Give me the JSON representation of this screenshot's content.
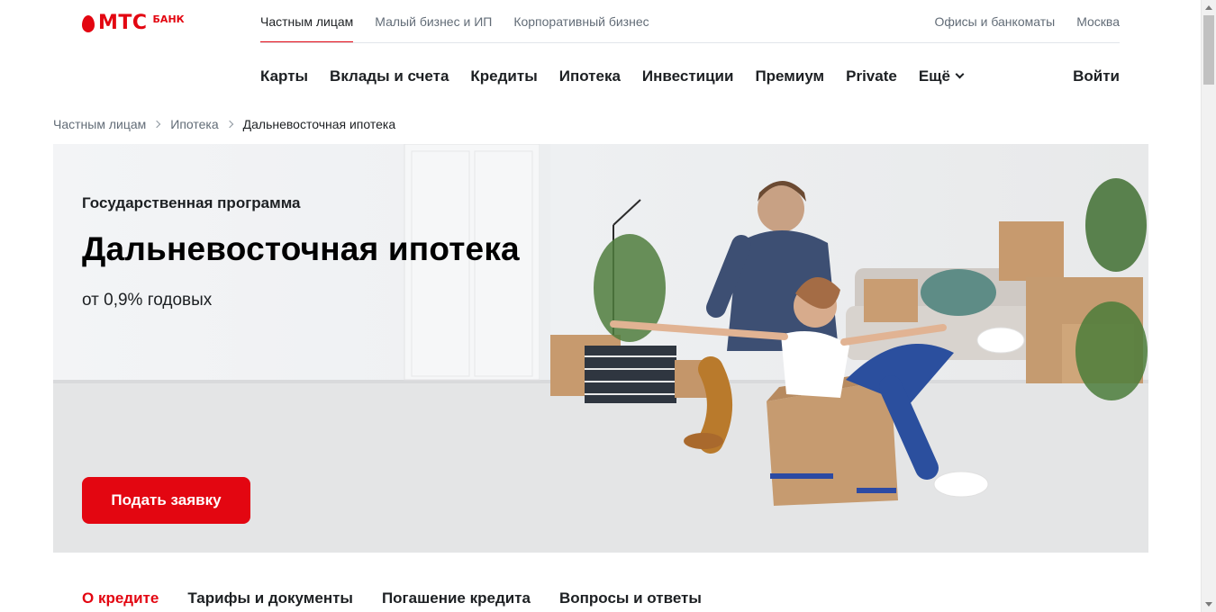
{
  "brand": {
    "name": "МТС",
    "sub": "БАНК",
    "color": "#e30611"
  },
  "topnav": {
    "segments": [
      "Частным лицам",
      "Малый бизнес и ИП",
      "Корпоративный бизнес"
    ],
    "right": [
      "Офисы и банкоматы",
      "Москва"
    ]
  },
  "mainnav": {
    "items": [
      "Карты",
      "Вклады и счета",
      "Кредиты",
      "Ипотека",
      "Инвестиции",
      "Премиум",
      "Private"
    ],
    "more": "Ещё",
    "login": "Войти"
  },
  "breadcrumb": [
    "Частным лицам",
    "Ипотека",
    "Дальневосточная ипотека"
  ],
  "hero": {
    "subtitle": "Государственная программа",
    "title": "Дальневосточная ипотека",
    "rate": "от 0,9% годовых",
    "button": "Подать заявку"
  },
  "tabs": [
    "О кредите",
    "Тарифы и документы",
    "Погашение кредита",
    "Вопросы и ответы"
  ]
}
